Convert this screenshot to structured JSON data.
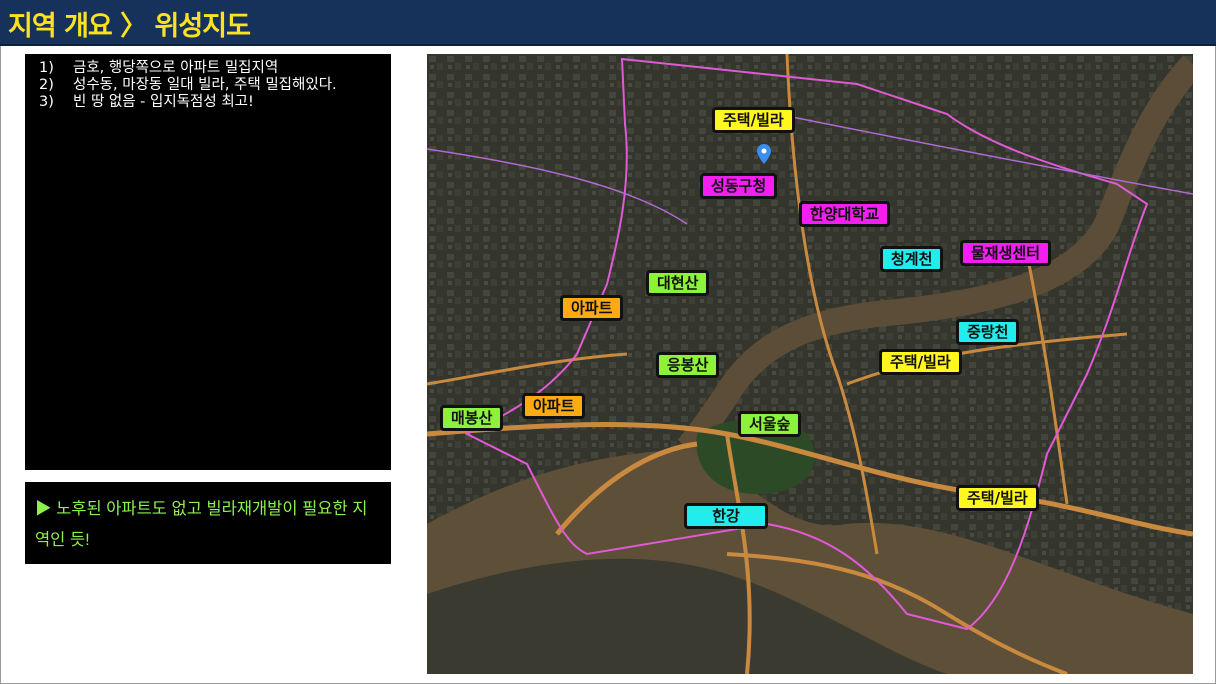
{
  "slide": {
    "title": "지역 개요 〉 위성지도"
  },
  "notes": [
    {
      "num": "1)",
      "text": "금호, 행당쪽으로 아파트 밀집지역"
    },
    {
      "num": "2)",
      "text": "성수동, 마장동 일대 빌라, 주택 밀집해있다."
    },
    {
      "num": "3)",
      "text": "빈 땅 없음 - 입지독점성 최고!"
    }
  ],
  "summary": {
    "text": "▶ 노후된 아파트도 없고 빌라재개발이 필요한 지역인 듯!"
  },
  "map_labels": [
    {
      "text": "주택/빌라",
      "category": "housing"
    },
    {
      "text": "성동구청",
      "category": "landmark"
    },
    {
      "text": "한양대학교",
      "category": "landmark"
    },
    {
      "text": "청계천",
      "category": "water"
    },
    {
      "text": "물재생센터",
      "category": "landmark"
    },
    {
      "text": "대현산",
      "category": "park"
    },
    {
      "text": "아파트",
      "category": "apartment"
    },
    {
      "text": "중랑천",
      "category": "water"
    },
    {
      "text": "응봉산",
      "category": "park"
    },
    {
      "text": "주택/빌라",
      "category": "housing"
    },
    {
      "text": "매봉산",
      "category": "park"
    },
    {
      "text": "아파트",
      "category": "apartment"
    },
    {
      "text": "서울숲",
      "category": "park"
    },
    {
      "text": "주택/빌라",
      "category": "housing"
    },
    {
      "text": "한강",
      "category": "water"
    }
  ],
  "colors": {
    "title_bg": "#17325a",
    "title_text": "#ffe21f",
    "summary_text": "#8df24e",
    "housing": "#fff71e",
    "landmark": "#f21ef2",
    "water": "#22ecec",
    "park": "#8cf23a",
    "apartment": "#ffaa12"
  },
  "icons": {
    "map_pin": "map-pin-icon"
  }
}
